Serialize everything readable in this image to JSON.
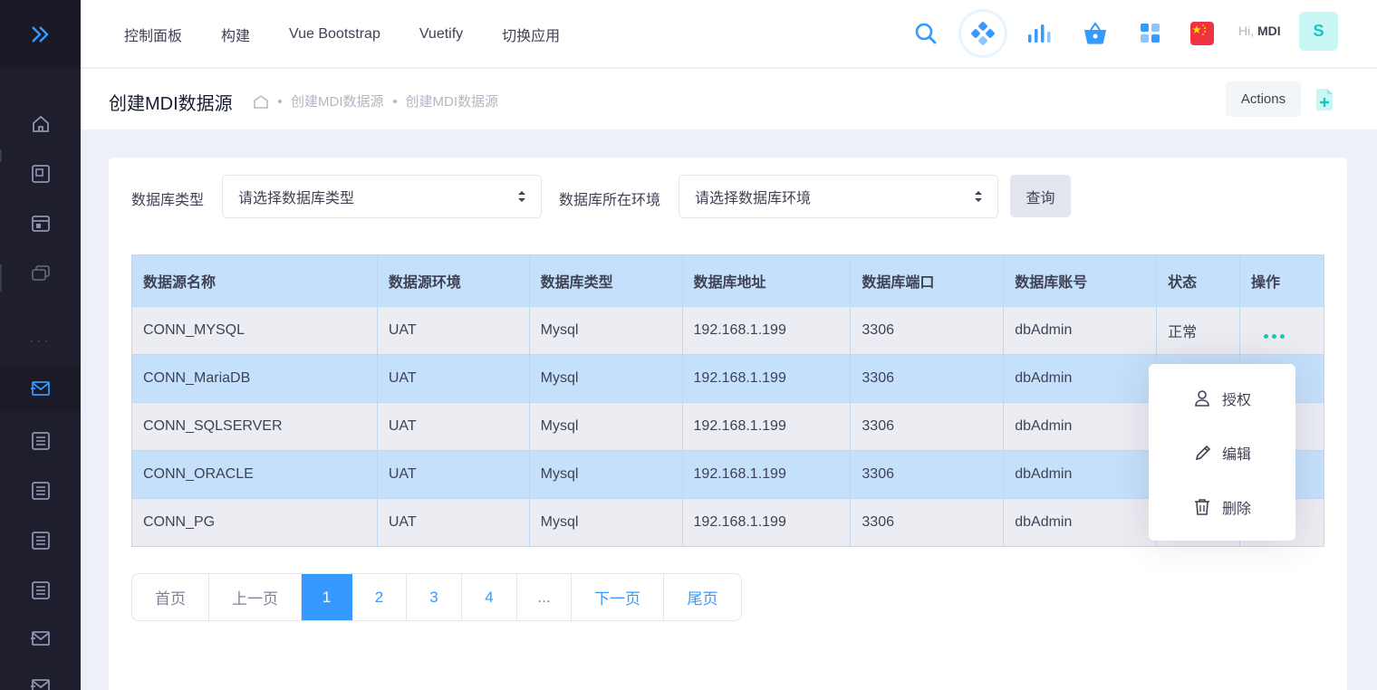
{
  "header": {
    "menu": [
      "控制面板",
      "构建",
      "Vue Bootstrap",
      "Vuetify",
      "切换应用"
    ],
    "greeting_prefix": "Hi,",
    "greeting_name": "MDI",
    "avatar_letter": "S",
    "icons": [
      "search-icon",
      "toggle-icon",
      "chart-bars-icon",
      "basket-icon",
      "apps-grid-icon",
      "china-flag-icon"
    ]
  },
  "sidebar": {
    "icons": [
      "expand-chevrons-icon",
      "home-icon",
      "layout-icon",
      "window-icon",
      "layers-icon",
      "mail-icon",
      "list-icon",
      "list-icon",
      "list-icon",
      "list-icon",
      "mail-icon",
      "mail-icon"
    ],
    "more": "···"
  },
  "subheader": {
    "title": "创建MDI数据源",
    "breadcrumbs": [
      "创建MDI数据源",
      "创建MDI数据源"
    ],
    "actions_label": "Actions"
  },
  "filters": {
    "db_type_label": "数据库类型",
    "db_type_placeholder": "请选择数据库类型",
    "db_env_label": "数据库所在环境",
    "db_env_placeholder": "请选择数据库环境",
    "query_label": "查询"
  },
  "table": {
    "columns": [
      "数据源名称",
      "数据源环境",
      "数据库类型",
      "数据库地址",
      "数据库端口",
      "数据库账号",
      "状态",
      "操作"
    ],
    "rows": [
      [
        "CONN_MYSQL",
        "UAT",
        "Mysql",
        "192.168.1.199",
        "3306",
        "dbAdmin",
        "正常"
      ],
      [
        "CONN_MariaDB",
        "UAT",
        "Mysql",
        "192.168.1.199",
        "3306",
        "dbAdmin",
        ""
      ],
      [
        "CONN_SQLSERVER",
        "UAT",
        "Mysql",
        "192.168.1.199",
        "3306",
        "dbAdmin",
        ""
      ],
      [
        "CONN_ORACLE",
        "UAT",
        "Mysql",
        "192.168.1.199",
        "3306",
        "dbAdmin",
        ""
      ],
      [
        "CONN_PG",
        "UAT",
        "Mysql",
        "192.168.1.199",
        "3306",
        "dbAdmin",
        ""
      ]
    ]
  },
  "dropdown": {
    "items": [
      "授权",
      "编辑",
      "删除"
    ]
  },
  "pager": {
    "first": "首页",
    "prev": "上一页",
    "pages": [
      "1",
      "2",
      "3",
      "4"
    ],
    "ellipsis": "...",
    "next": "下一页",
    "last": "尾页",
    "current": "1"
  },
  "colors": {
    "sidebar_bg": "#1e1e2d",
    "accent": "#3699ff",
    "teal": "#1bc5bd",
    "table_header": "#c5e0fb",
    "row_grey": "#ebedf2"
  }
}
